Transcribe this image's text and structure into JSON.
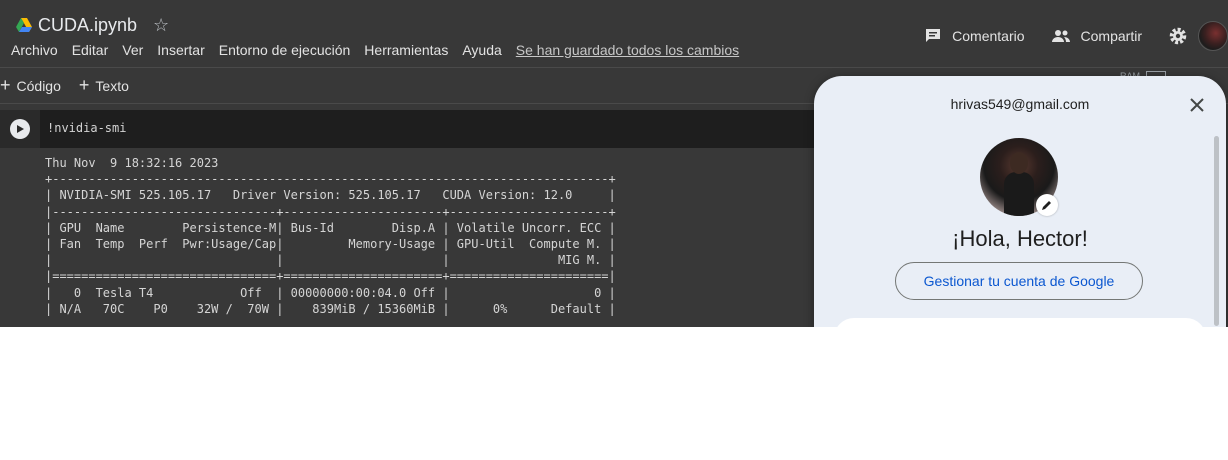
{
  "header": {
    "doc_title": "CUDA.ipynb",
    "menu": [
      "Archivo",
      "Editar",
      "Ver",
      "Insertar",
      "Entorno de ejecución",
      "Herramientas",
      "Ayuda"
    ],
    "save_status": "Se han guardado todos los cambios",
    "comment_label": "Comentario",
    "share_label": "Compartir"
  },
  "toolbar": {
    "code_label": "Código",
    "text_label": "Texto",
    "ram_label": "RAM"
  },
  "cell": {
    "code": "!nvidia-smi",
    "output": "Thu Nov  9 18:32:16 2023\n+-----------------------------------------------------------------------------+\n| NVIDIA-SMI 525.105.17   Driver Version: 525.105.17   CUDA Version: 12.0     |\n|-------------------------------+----------------------+----------------------+\n| GPU  Name        Persistence-M| Bus-Id        Disp.A | Volatile Uncorr. ECC |\n| Fan  Temp  Perf  Pwr:Usage/Cap|         Memory-Usage | GPU-Util  Compute M. |\n|                               |                      |               MIG M. |\n|===============================+======================+======================|\n|   0  Tesla T4            Off  | 00000000:00:04.0 Off |                    0 |\n| N/A   70C    P0    32W /  70W |    839MiB / 15360MiB |      0%      Default |"
  },
  "account_popup": {
    "email": "hrivas549@gmail.com",
    "greeting": "¡Hola, Hector!",
    "manage_label": "Gestionar tu cuenta de Google"
  },
  "colors": {
    "app_bg": "#383838",
    "popup_bg": "#e9eef6",
    "link_blue": "#0b57d0"
  }
}
